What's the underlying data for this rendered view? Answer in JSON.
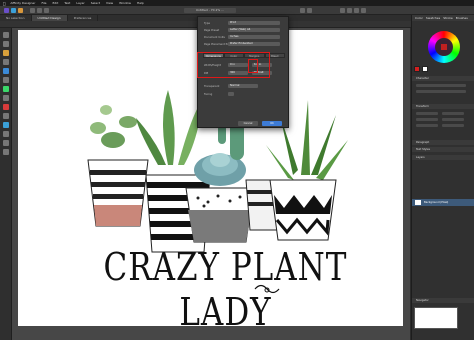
{
  "menubar": {
    "app": "Affinity Designer",
    "items": [
      "File",
      "Edit",
      "Text",
      "Layer",
      "Select",
      "View",
      "Window",
      "Help"
    ]
  },
  "toolbar": {
    "doc_title": "Untitled - 70.1% ..."
  },
  "tabs": [
    {
      "label": "No selection",
      "active": false
    },
    {
      "label": "Untitled Design",
      "active": true
    },
    {
      "label": "Preferences",
      "active": false
    }
  ],
  "dialog": {
    "rows": [
      {
        "label": "Type",
        "value": "Print"
      },
      {
        "label": "Page Preset",
        "value": "Letter (Web) A4"
      },
      {
        "label": "Document Units",
        "value": "Inches"
      },
      {
        "label": "Page Placement Policy",
        "value": "Prefer Embedded"
      }
    ],
    "tabs": [
      "Dimensions",
      "Color",
      "Margins",
      "Bleed"
    ],
    "active_tab": "Dimensions",
    "fields": [
      {
        "label": "Width/Height",
        "value": "9 in",
        "value2": "6.6 in"
      },
      {
        "label": "DPI",
        "value": "300",
        "value2": "Portrait"
      }
    ],
    "extra": [
      {
        "label": "Transparent",
        "value": "Normal"
      },
      {
        "label": "Facing",
        "value": ""
      }
    ],
    "buttons": [
      "Cancel",
      "OK"
    ]
  },
  "artwork": {
    "headline": "CRAZY PLANT LADY"
  },
  "panel": {
    "tabs": [
      "Color",
      "Swatches",
      "Stroke",
      "Brushes"
    ],
    "sections": [
      "Character",
      "Transform",
      "Paragraph",
      "Text Styles",
      "Layers",
      "Navigator"
    ],
    "layer_name": "Background (Pixel)",
    "colors": {
      "red": "#d31f1f",
      "accent": "#3d5a7a"
    }
  }
}
